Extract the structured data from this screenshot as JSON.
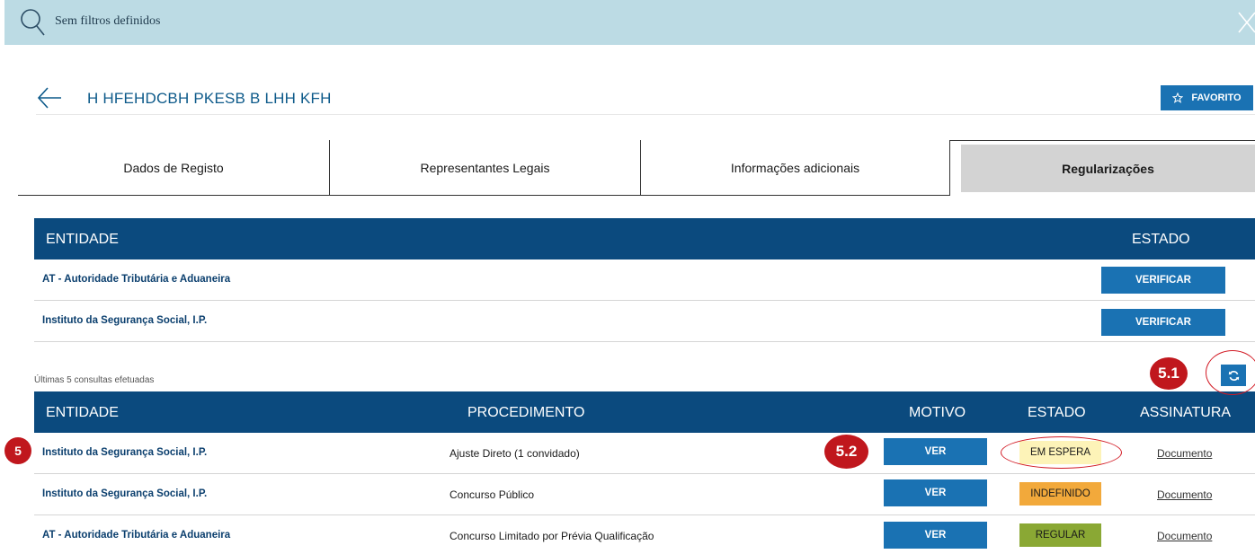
{
  "filter_bar": {
    "text": "Sem filtros definidos"
  },
  "header": {
    "title": "H HFEHDCBH PKESB B LHH KFH",
    "favorite_label": "FAVORITO"
  },
  "tabs": [
    {
      "label": "Dados de Registo",
      "active": false
    },
    {
      "label": "Representantes Legais",
      "active": false
    },
    {
      "label": "Informações adicionais",
      "active": false
    },
    {
      "label": "Regularizações",
      "active": true
    }
  ],
  "entities_table": {
    "headers": {
      "entidade": "ENTIDADE",
      "estado": "ESTADO"
    },
    "rows": [
      {
        "entidade": "AT - Autoridade Tributária e Aduaneira",
        "action": "VERIFICAR"
      },
      {
        "entidade": "Instituto da Segurança Social, I.P.",
        "action": "VERIFICAR"
      }
    ]
  },
  "consultations": {
    "label": "Últimas 5 consultas efetuadas",
    "headers": {
      "entidade": "ENTIDADE",
      "procedimento": "PROCEDIMENTO",
      "motivo": "MOTIVO",
      "estado": "ESTADO",
      "assinatura": "ASSINATURA"
    },
    "rows": [
      {
        "entidade": "Instituto da Segurança Social, I.P.",
        "procedimento": "Ajuste Direto (1 convidado)",
        "motivo": "VER",
        "estado": "EM ESPERA",
        "estado_color": "#fdf3b8",
        "assinatura": "Documento"
      },
      {
        "entidade": "Instituto da Segurança Social, I.P.",
        "procedimento": "Concurso Público",
        "motivo": "VER",
        "estado": "INDEFINIDO",
        "estado_color": "#f2a93b",
        "assinatura": "Documento"
      },
      {
        "entidade": "AT - Autoridade Tributária e Aduaneira",
        "procedimento": "Concurso Limitado por Prévia Qualificação",
        "motivo": "VER",
        "estado": "REGULAR",
        "estado_color": "#8aa834",
        "assinatura": "Documento"
      }
    ]
  },
  "annotations": {
    "badge_5": "5",
    "badge_5_1": "5.1",
    "badge_5_2": "5.2"
  },
  "colors": {
    "header_blue": "#0b4a7e",
    "button_blue": "#1a72b3",
    "filter_bg": "#bcdbe4",
    "callout_red": "#c0171d"
  }
}
